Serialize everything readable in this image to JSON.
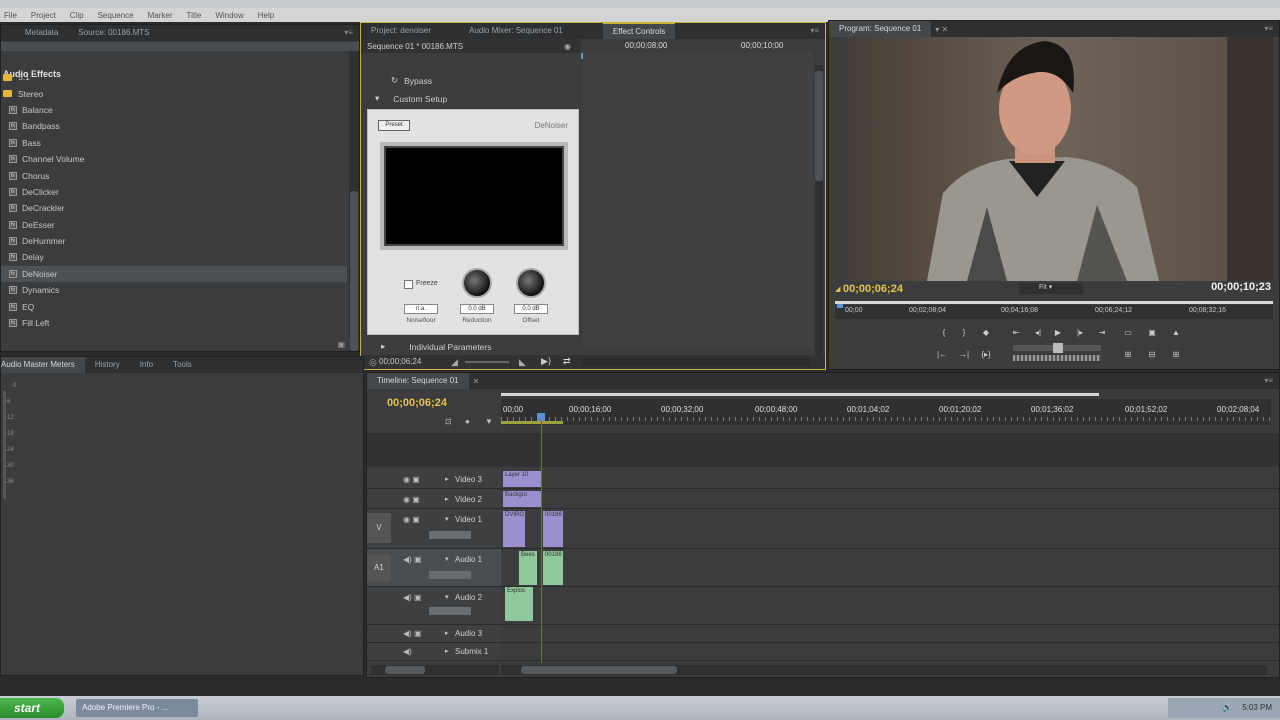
{
  "menubar": {
    "items": [
      "File",
      "Project",
      "Clip",
      "Sequence",
      "Marker",
      "Title",
      "Window",
      "Help"
    ]
  },
  "effects_panel": {
    "tabs": [
      "Metadata",
      "Source: 00186.MTS"
    ],
    "header": "Audio Effects",
    "folders": [
      "5.1",
      "Stereo"
    ],
    "items": [
      "Balance",
      "Bandpass",
      "Bass",
      "Channel Volume",
      "Chorus",
      "DeClicker",
      "DeCrackler",
      "DeEsser",
      "DeHummer",
      "Delay",
      "DeNoiser",
      "Dynamics",
      "EQ",
      "Fill Left"
    ],
    "selected": "DeNoiser",
    "icon": "audio-effect-icon"
  },
  "effect_controls": {
    "tabs": [
      "Project: denoiser",
      "Audio Mixer: Sequence 01",
      "Effect Controls"
    ],
    "sequence_label": "Sequence 01 * 00186.MTS",
    "ruler_times": [
      "00;00;08;00",
      "00;00;10;00"
    ],
    "bypass_label": "Bypass",
    "custom_setup_label": "Custom Setup",
    "individual_params_label": "Individual Parameters",
    "current_time": "00;00;06;24",
    "plugin": {
      "preset_label": "Preset",
      "title": "DeNoiser",
      "freeze_label": "Freeze",
      "knobs": [
        {
          "label": "Noisefloor",
          "value": "n.a."
        },
        {
          "label": "Reduction",
          "value": "0.0 dB"
        },
        {
          "label": "Offset",
          "value": "0.0 dB"
        }
      ]
    }
  },
  "program_monitor": {
    "tab": "Program: Sequence 01",
    "current_time": "00;00;06;24",
    "duration": "00;00;10;23",
    "fit_label": "Fit",
    "ruler_times": [
      "00;00",
      "00;02;08;04",
      "00;04;16;08",
      "00;06;24;12",
      "00;08;32;16"
    ]
  },
  "meters_panel": {
    "tabs": [
      "Audio Master Meters",
      "History",
      "Info",
      "Tools"
    ],
    "scale": [
      "0",
      "-6",
      "-12",
      "-18",
      "-24",
      "-30",
      "-36"
    ]
  },
  "timeline": {
    "tab": "Timeline: Sequence 01",
    "current_time": "00;00;06;24",
    "ruler_times": [
      "00;00",
      "00;00;16;00",
      "00;00;32;00",
      "00;00;48;00",
      "00;01;04;02",
      "00;01;20;02",
      "00;01;36;02",
      "00;01;52;02",
      "00;02;08;04"
    ],
    "tracks": [
      {
        "name": "Video 3",
        "kind": "video"
      },
      {
        "name": "Video 2",
        "kind": "video"
      },
      {
        "name": "Video 1",
        "kind": "video",
        "target": "V"
      },
      {
        "name": "Audio 1",
        "kind": "audio",
        "target": "A1"
      },
      {
        "name": "Audio 2",
        "kind": "audio"
      },
      {
        "name": "Audio 3",
        "kind": "audio"
      },
      {
        "name": "Submix 1",
        "kind": "audio"
      }
    ],
    "clips": {
      "v3": "Layer 10",
      "v2": "Backgro",
      "v1a": "DVIRO",
      "v1b": "00186",
      "a1a": "Bees",
      "a1b": "00186",
      "a2": "Explos"
    }
  },
  "taskbar": {
    "start_label": "start",
    "task_label": "Adobe Premiere Pro - ...",
    "tray_text": "5:03 PM"
  },
  "colors": {
    "timecode": "#e8c24a",
    "playhead": "#d83a3a",
    "video_clip": "#9c8fd0",
    "audio_clip": "#8fc89a"
  }
}
